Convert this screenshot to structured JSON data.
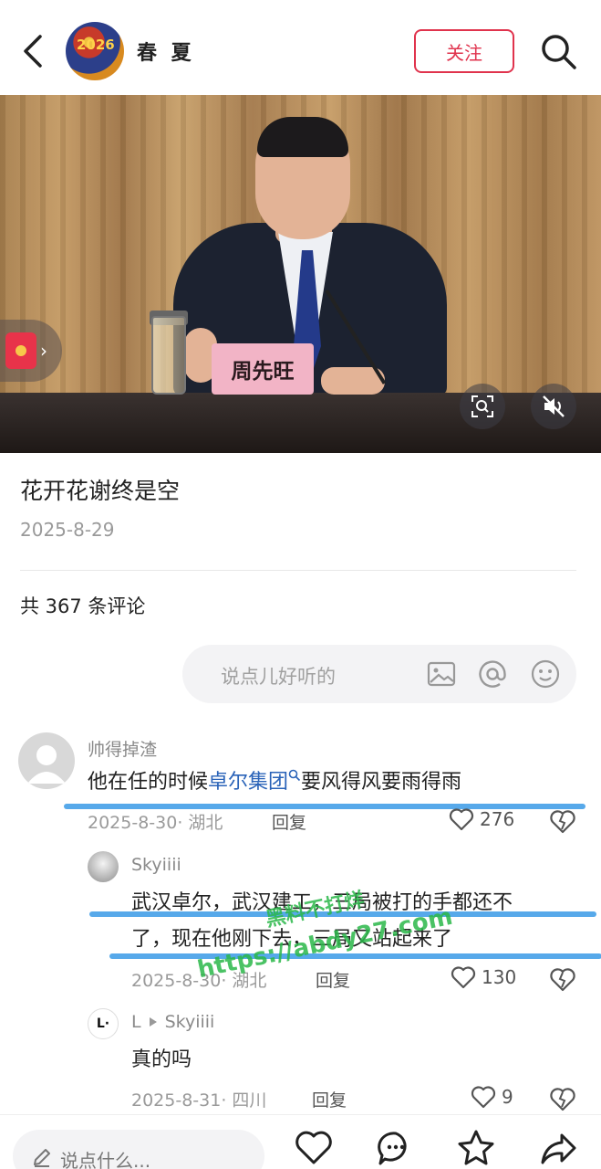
{
  "header": {
    "author_name": "春 夏",
    "avatar_text": "2026",
    "follow_label": "关注"
  },
  "photo": {
    "nameplate_text": "周先旺"
  },
  "post": {
    "title": "花开花谢终是空",
    "date": "2025-8-29",
    "comment_count_label": "共 367 条评论"
  },
  "comment_input": {
    "placeholder": "说点儿好听的"
  },
  "comments": [
    {
      "username": "帅得掉渣",
      "text_before_link": "他在任的时候",
      "link_text": "卓尔集团",
      "text_after_link": "要风得风要雨得雨",
      "meta": "2025-8-30· 湖北",
      "reply_label": "回复",
      "likes": "276"
    },
    {
      "username": "Skyiiii",
      "text_line1": "武汉卓尔，武汉建工，三局被打的手都还不",
      "text_line2": "了，现在他刚下去，三局又站起来了",
      "meta": "2025-8-30· 湖北",
      "reply_label": "回复",
      "likes": "130"
    },
    {
      "username": "L",
      "reply_to": "Skyiiii",
      "avatar_text": "L·",
      "text": "真的吗",
      "meta": "2025-8-31· 四川",
      "reply_label": "回复",
      "likes": "9"
    }
  ],
  "watermark": {
    "line1": "黑料不打烊",
    "line2": "https://abdy27.com"
  },
  "bottom_bar": {
    "input_placeholder": "说点什么..."
  },
  "colors": {
    "accent": "#e0334d",
    "link": "#2a63b8",
    "muted": "#9a9a9a"
  },
  "icons": [
    "back-icon",
    "search-icon",
    "red-envelope-icon",
    "ocr-icon",
    "mute-icon",
    "image-icon",
    "at-icon",
    "emoji-icon",
    "heart-icon",
    "dislike-icon",
    "pen-icon",
    "comment-icon",
    "star-icon",
    "share-icon"
  ]
}
